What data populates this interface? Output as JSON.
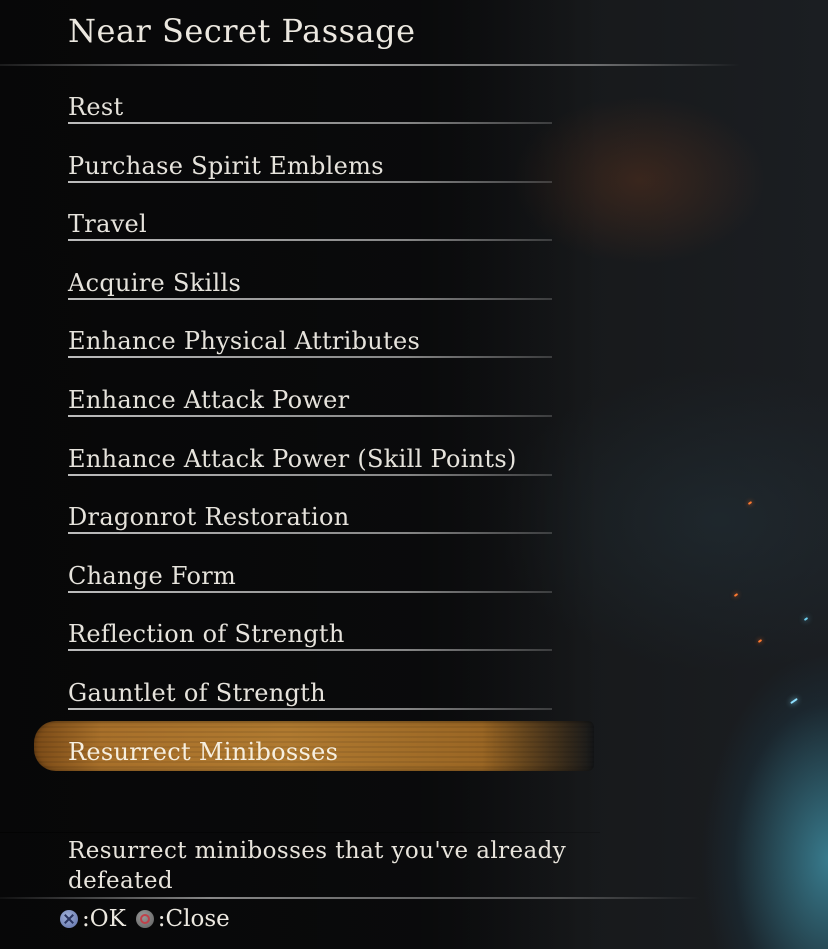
{
  "menu_title": "Near Secret Passage",
  "menu_items": [
    {
      "label": "Rest"
    },
    {
      "label": "Purchase Spirit Emblems"
    },
    {
      "label": "Travel"
    },
    {
      "label": "Acquire Skills"
    },
    {
      "label": "Enhance Physical Attributes"
    },
    {
      "label": "Enhance Attack Power"
    },
    {
      "label": "Enhance Attack Power (Skill Points)"
    },
    {
      "label": "Dragonrot Restoration"
    },
    {
      "label": "Change Form"
    },
    {
      "label": "Reflection of Strength"
    },
    {
      "label": "Gauntlet of Strength"
    },
    {
      "label": "Resurrect Minibosses",
      "selected": true
    }
  ],
  "description": "Resurrect minibosses that you've already defeated",
  "footer": {
    "ok_icon": "cross-button-icon",
    "ok_label": ":OK",
    "close_icon": "circle-button-icon",
    "close_label": ":Close"
  },
  "colors": {
    "highlight": "#b07a30",
    "text": "#e9e6df",
    "glow": "#50c8e6"
  }
}
